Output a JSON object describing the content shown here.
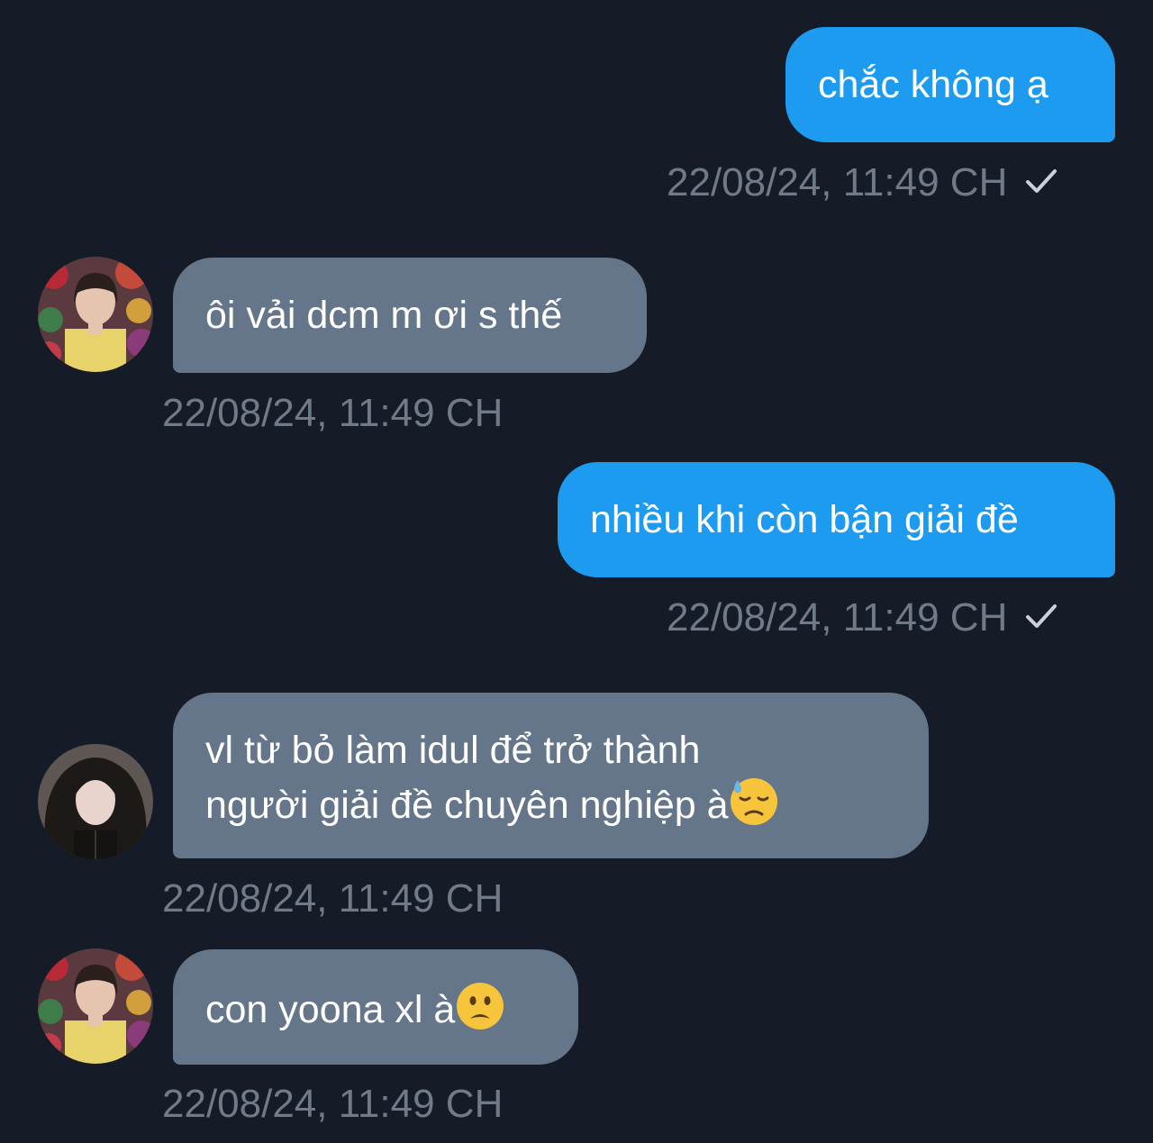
{
  "messages": [
    {
      "direction": "outgoing",
      "text": "chắc không ạ",
      "timestamp": "22/08/24, 11:49 CH",
      "status_icon": "check-icon"
    },
    {
      "direction": "incoming",
      "text": "ôi vải dcm m ơi s thế",
      "timestamp": "22/08/24, 11:49 CH",
      "avatar": "avatar-girl-colorful"
    },
    {
      "direction": "outgoing",
      "text": "nhiều khi còn bận giải đề",
      "timestamp": "22/08/24, 11:49 CH",
      "status_icon": "check-icon"
    },
    {
      "direction": "incoming",
      "line1": "vl từ bỏ làm idul để trở thành",
      "line2": "người giải đề chuyên nghiệp à",
      "emoji": "downcast-face-with-sweat-emoji",
      "timestamp": "22/08/24, 11:49 CH",
      "avatar": "avatar-girl-dark-hair"
    },
    {
      "direction": "incoming",
      "text": "con yoona xl à",
      "emoji": "frowning-face-emoji",
      "timestamp": "22/08/24, 11:49 CH",
      "avatar": "avatar-girl-colorful"
    }
  ],
  "colors": {
    "background": "#151c27",
    "outgoing_bubble": "#1d9bf0",
    "incoming_bubble": "#66768a",
    "timestamp": "#6f7b89",
    "text": "#ffffff"
  }
}
